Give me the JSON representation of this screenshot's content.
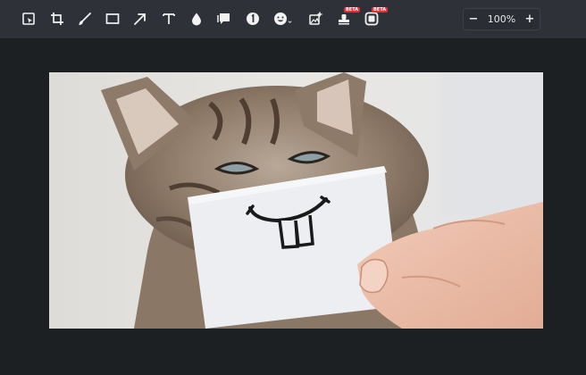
{
  "toolbar": {
    "tools": [
      {
        "name": "select-tool",
        "icon": "select-icon"
      },
      {
        "name": "crop-tool",
        "icon": "crop-icon"
      },
      {
        "name": "pen-tool",
        "icon": "pen-icon"
      },
      {
        "name": "rectangle-tool",
        "icon": "rectangle-icon"
      },
      {
        "name": "arrow-tool",
        "icon": "arrow-icon"
      },
      {
        "name": "text-tool",
        "icon": "text-icon"
      },
      {
        "name": "blur-tool",
        "icon": "droplet-icon"
      },
      {
        "name": "speech-bubble-tool",
        "icon": "speech-bubble-icon"
      },
      {
        "name": "step-number-tool",
        "icon": "number-circle-icon"
      },
      {
        "name": "emoji-tool",
        "icon": "smiley-icon"
      },
      {
        "name": "add-image-tool",
        "icon": "image-plus-icon"
      },
      {
        "name": "stamp-tool",
        "icon": "stamp-icon",
        "badge": "BETA"
      },
      {
        "name": "frame-tool",
        "icon": "frame-icon",
        "badge": "BETA"
      }
    ],
    "zoom": {
      "minus_label": "−",
      "level": "100%",
      "plus_label": "+"
    }
  },
  "colors": {
    "toolbar_bg": "#2e3138",
    "canvas_bg": "#1c2022",
    "icon": "#f2f2f2",
    "beta_badge": "#e0303c"
  }
}
